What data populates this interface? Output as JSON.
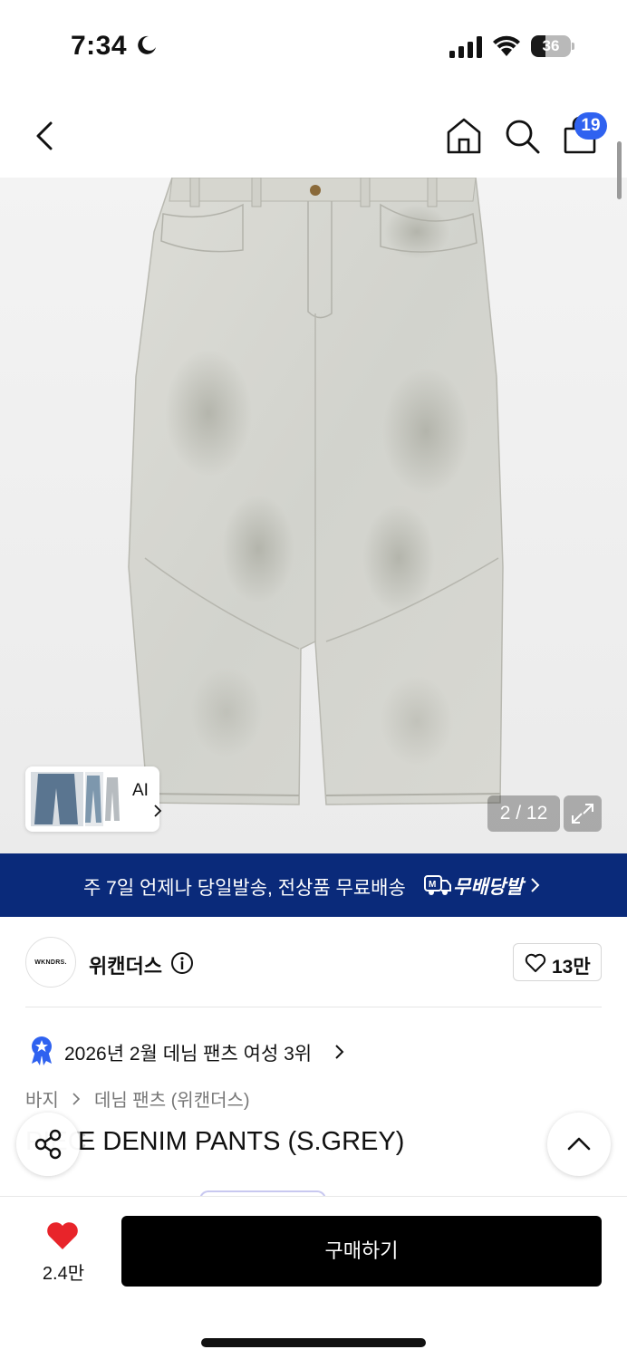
{
  "status_bar": {
    "time": "7:34",
    "battery_level": "36"
  },
  "nav": {
    "cart_count": "19"
  },
  "gallery": {
    "ai_label": "AI",
    "page_counter": "2 / 12"
  },
  "banner": {
    "text": "주 7일 언제나 당일발송, 전상품 무료배송",
    "badge_label": "무배당발",
    "colors": {
      "background": "#0a2a7a"
    }
  },
  "brand": {
    "logo_text": "WKNDRS.",
    "name": "위캔더스",
    "like_count": "13만"
  },
  "ranking": {
    "text": "2026년 2월 데님 팬츠 여성 3위"
  },
  "breadcrumb": {
    "items": [
      "바지",
      "데님 팬츠 (위캔더스)"
    ]
  },
  "product": {
    "title_visible": "E DENIM PANTS (S.GREY)",
    "title_obscured": "PIEC"
  },
  "bottom_bar": {
    "wishlist_count": "2.4만",
    "buy_label": "구매하기",
    "colors": {
      "heart": "#e8242a",
      "buy_button": "#000000"
    }
  },
  "icons": {
    "back": "chevron-left-icon",
    "home": "home-icon",
    "search": "search-icon",
    "cart": "shopping-bag-icon",
    "expand": "expand-icon",
    "info": "info-icon",
    "share": "share-icon",
    "scroll_top": "chevron-up-icon"
  }
}
